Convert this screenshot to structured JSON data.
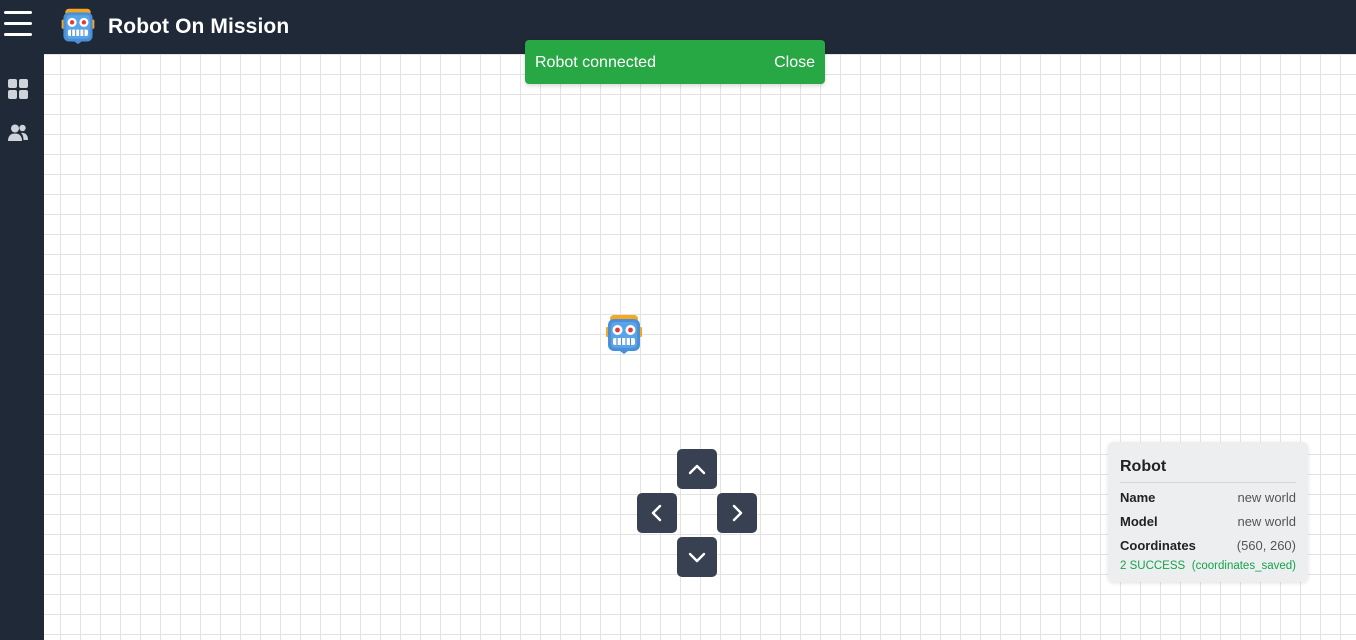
{
  "app": {
    "title": "Robot On Mission",
    "logo_icon": "robot-face-icon"
  },
  "sidebar": {
    "items": [
      {
        "icon": "dashboard-grid-icon",
        "label": ""
      },
      {
        "icon": "users-icon",
        "label": ""
      }
    ]
  },
  "toast": {
    "message": "Robot connected",
    "close_label": "Close",
    "color": "#28a745"
  },
  "controls": {
    "up_icon": "chevron-up-icon",
    "left_icon": "chevron-left-icon",
    "right_icon": "chevron-right-icon",
    "down_icon": "chevron-down-icon"
  },
  "robot_panel": {
    "title": "Robot",
    "fields": [
      {
        "label": "Name",
        "value": "new world"
      },
      {
        "label": "Model",
        "value": "new world"
      },
      {
        "label": "Coordinates",
        "value": "(560, 260)"
      }
    ],
    "status": {
      "code": "2 SUCCESS",
      "detail": "(coordinates_saved)",
      "color": "#16a34a"
    }
  },
  "colors": {
    "header_bg": "#1f2937",
    "control_bg": "#374151",
    "grid_line": "#e3e3e3"
  }
}
